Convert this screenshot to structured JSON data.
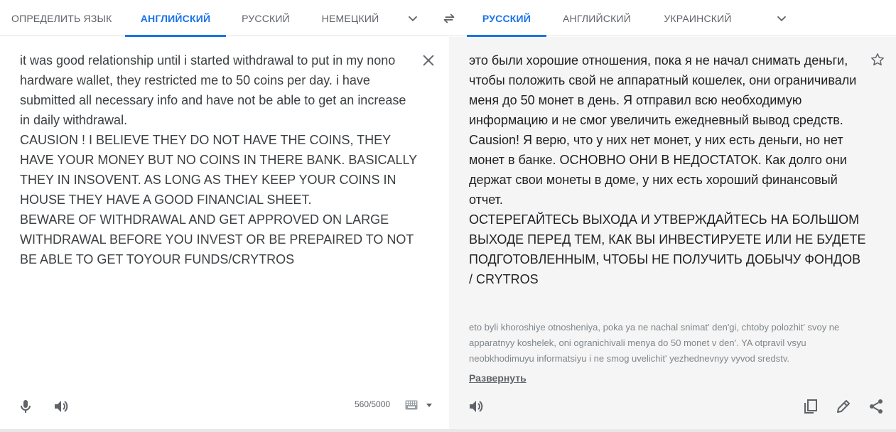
{
  "source_tabs": [
    {
      "label": "ОПРЕДЕЛИТЬ ЯЗЫК",
      "active": false
    },
    {
      "label": "АНГЛИЙСКИЙ",
      "active": true
    },
    {
      "label": "РУССКИЙ",
      "active": false
    },
    {
      "label": "НЕМЕЦКИЙ",
      "active": false
    }
  ],
  "target_tabs": [
    {
      "label": "РУССКИЙ",
      "active": true
    },
    {
      "label": "АНГЛИЙСКИЙ",
      "active": false
    },
    {
      "label": "УКРАИНСКИЙ",
      "active": false
    }
  ],
  "source": {
    "text": "it was good relationship until i started withdrawal to put in my nono hardware wallet, they restricted me to 50 coins per day. i have submitted all necessary info and have not be able to get an increase in daily withdrawal.\nCAUSION ! I BELIEVE THEY DO NOT HAVE THE COINS, THEY HAVE YOUR MONEY BUT NO COINS IN THERE BANK. BASICALLY THEY IN INSOVENT. AS LONG AS THEY KEEP YOUR COINS IN HOUSE THEY HAVE A GOOD FINANCIAL SHEET.\nBEWARE OF WITHDRAWAL AND GET APPROVED ON LARGE WITHDRAWAL BEFORE YOU INVEST OR BE PREPAIRED TO NOT BE ABLE TO GET TOYOUR FUNDS/CRYTROS",
    "char_count": "560/5000"
  },
  "target": {
    "text": "это были хорошие отношения, пока я не начал снимать деньги, чтобы положить свой не аппаратный кошелек, они ограничивали меня до 50 монет в день. Я отправил всю необходимую информацию и не смог увеличить ежедневный вывод средств.\nCausion! Я верю, что у них нет монет, у них есть деньги, но нет монет в банке. ОСНОВНО ОНИ В НЕДОСТАТОК. Как долго они держат свои монеты в доме, у них есть хороший финансовый отчет.\nОСТЕРЕГАЙТЕСЬ ВЫХОДА И УТВЕРЖДАЙТЕСЬ НА БОЛЬШОМ ВЫХОДЕ ПЕРЕД ТЕМ, КАК ВЫ ИНВЕСТИРУЕТЕ ИЛИ НЕ БУДЕТЕ ПОДГОТОВЛЕННЫМ, ЧТОБЫ НЕ ПОЛУЧИТЬ ДОБЫЧУ ФОНДОВ\n/ CRYTROS",
    "transliteration": "eto byli khoroshiye otnosheniya, poka ya ne nachal snimat' den'gi, chtoby polozhit' svoy ne apparatnyy koshelek, oni ogranichivali menya do 50 monet v den'. YA otpravil vsyu neobkhodimuyu informatsiyu i ne smog uvelichit' yezhednevnyy vyvod sredstv.",
    "expand_label": "Развернуть"
  },
  "icons": {
    "more_source": "chevron-down-icon",
    "swap": "swap-arrows-icon",
    "more_target": "chevron-down-icon",
    "clear": "close-icon",
    "star": "star-icon",
    "mic": "microphone-icon",
    "listen": "speaker-icon",
    "keyboard": "keyboard-icon",
    "copy": "copy-icon",
    "edit": "pencil-icon",
    "share": "share-icon"
  },
  "colors": {
    "accent": "#1a73e8",
    "target_bg": "#f5f5f5",
    "text": "#3c4043",
    "muted": "#5f6368"
  }
}
